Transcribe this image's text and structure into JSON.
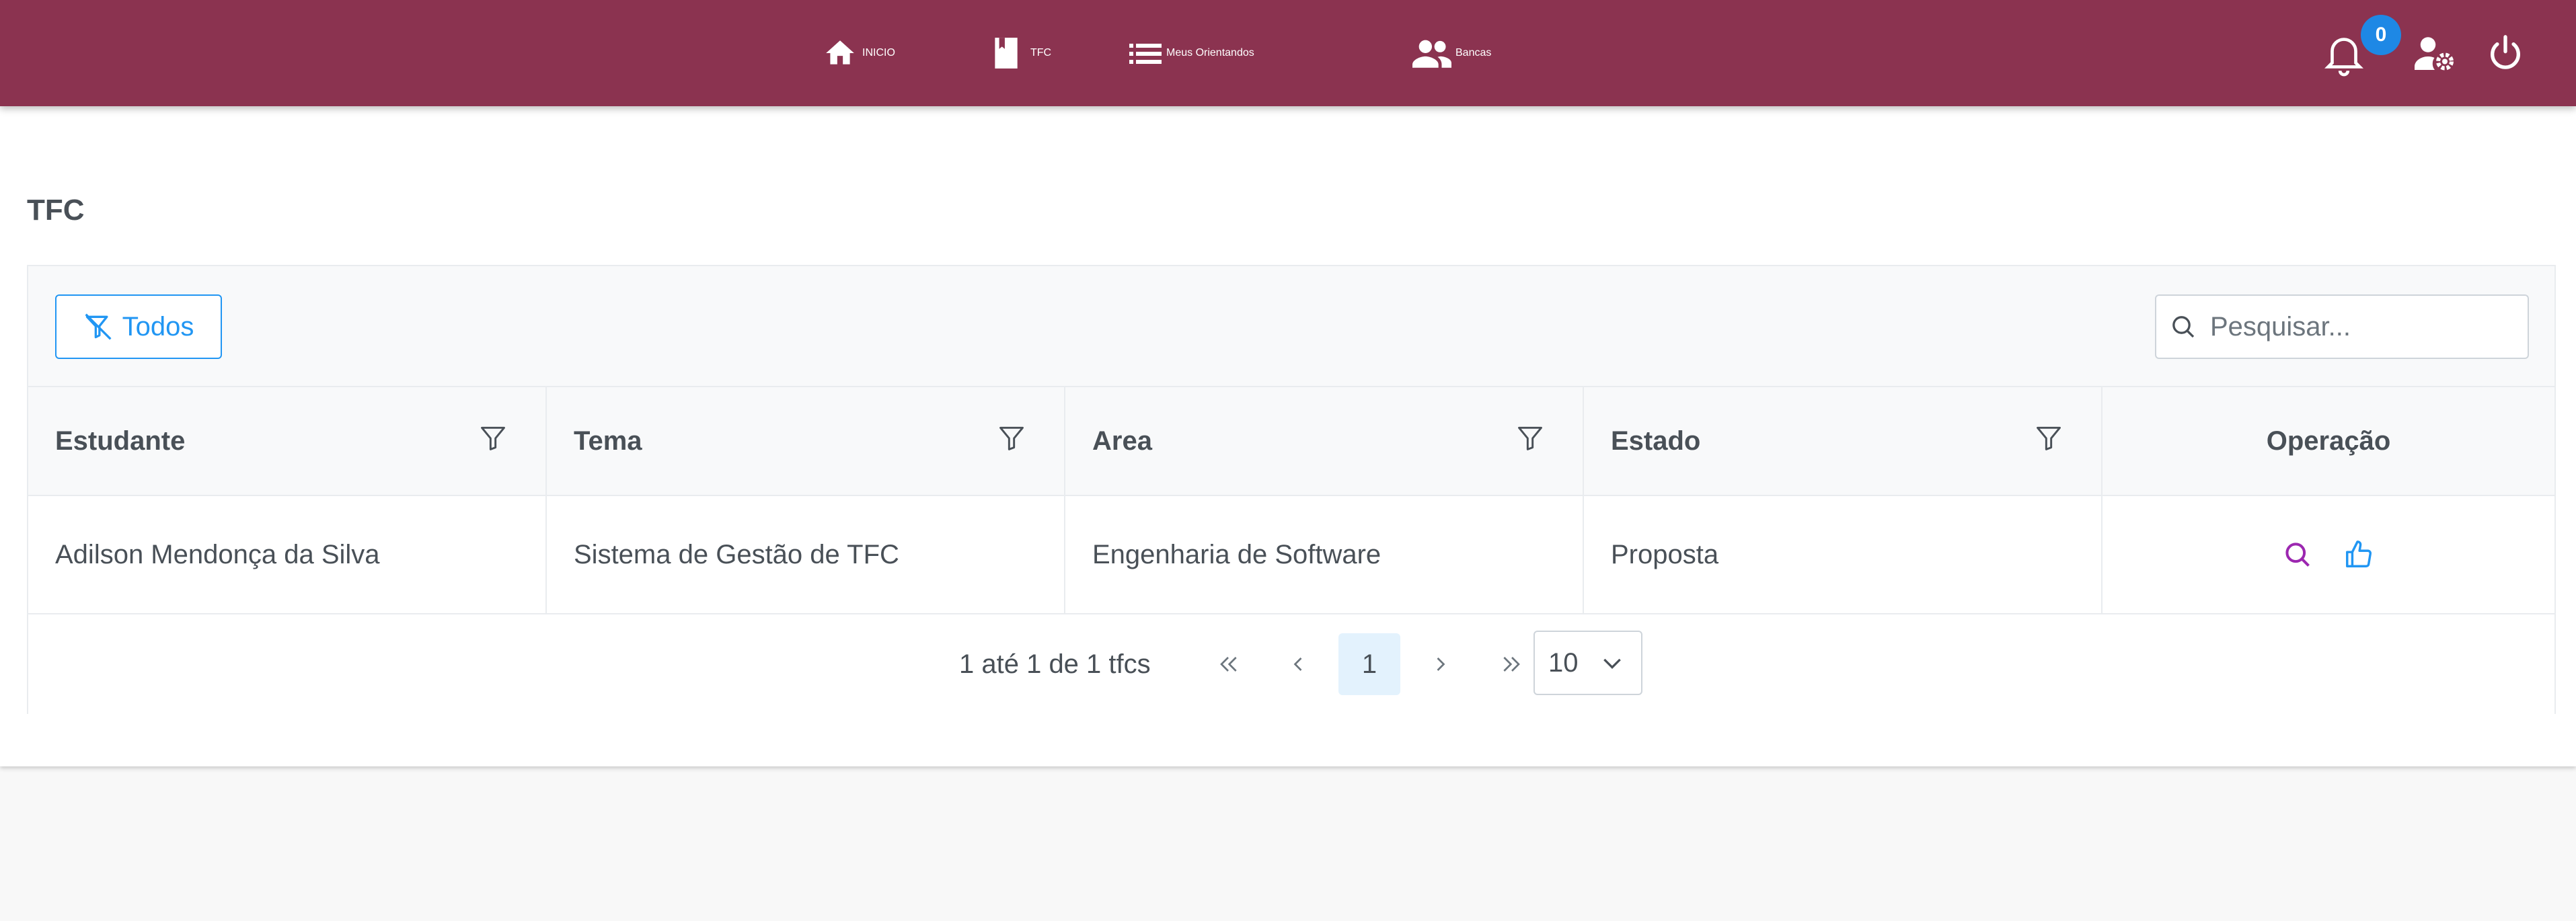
{
  "nav": {
    "items": [
      {
        "label": "INICIO",
        "icon": "home-icon"
      },
      {
        "label": "TFC",
        "icon": "book-icon"
      },
      {
        "label": "Meus Orientandos",
        "icon": "list-icon"
      },
      {
        "label": "Bancas",
        "icon": "people-icon"
      }
    ],
    "notifications_count": "0",
    "right_icons": [
      "bell-icon",
      "user-settings-icon",
      "power-icon"
    ]
  },
  "page": {
    "title": "TFC"
  },
  "toolbar": {
    "filter_button_label": "Todos",
    "search_placeholder": "Pesquisar..."
  },
  "table": {
    "columns": [
      "Estudante",
      "Tema",
      "Area",
      "Estado",
      "Operação"
    ],
    "rows": [
      {
        "estudante": "Adilson Mendonça da Silva",
        "tema": "Sistema de Gestão de TFC",
        "area": "Engenharia de Software",
        "estado": "Proposta"
      }
    ]
  },
  "paginator": {
    "report": "1 até 1 de 1 tfcs",
    "current_page": "1",
    "rows_per_page": "10"
  },
  "colors": {
    "topbar": "#8b3350",
    "accent": "#2196f3",
    "view_icon": "#9c27b0",
    "badge": "#1e88e5"
  }
}
